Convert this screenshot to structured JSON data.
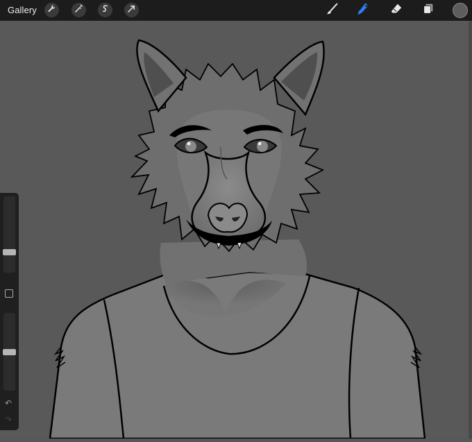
{
  "app": {
    "gallery_label": "Gallery"
  },
  "toolbar_left": [
    {
      "icon": "wrench-icon"
    },
    {
      "icon": "magic-wand-icon"
    },
    {
      "icon": "selection-s-icon"
    },
    {
      "icon": "transform-arrow-icon"
    }
  ],
  "toolbar_right": [
    {
      "icon": "brush-icon",
      "active": false
    },
    {
      "icon": "smudge-icon",
      "active": true
    },
    {
      "icon": "eraser-icon",
      "active": false
    },
    {
      "icon": "layers-icon",
      "active": false
    },
    {
      "icon": "color-swatch"
    }
  ],
  "colors": {
    "toolbar_bg": "#1c1c1c",
    "canvas_bg": "#595959",
    "active_tool": "#2f7df6",
    "current_color": "#5d5d5d"
  },
  "sidebar": {
    "size_slider_level": 0.25,
    "opacity_slider_level": 0.5
  }
}
